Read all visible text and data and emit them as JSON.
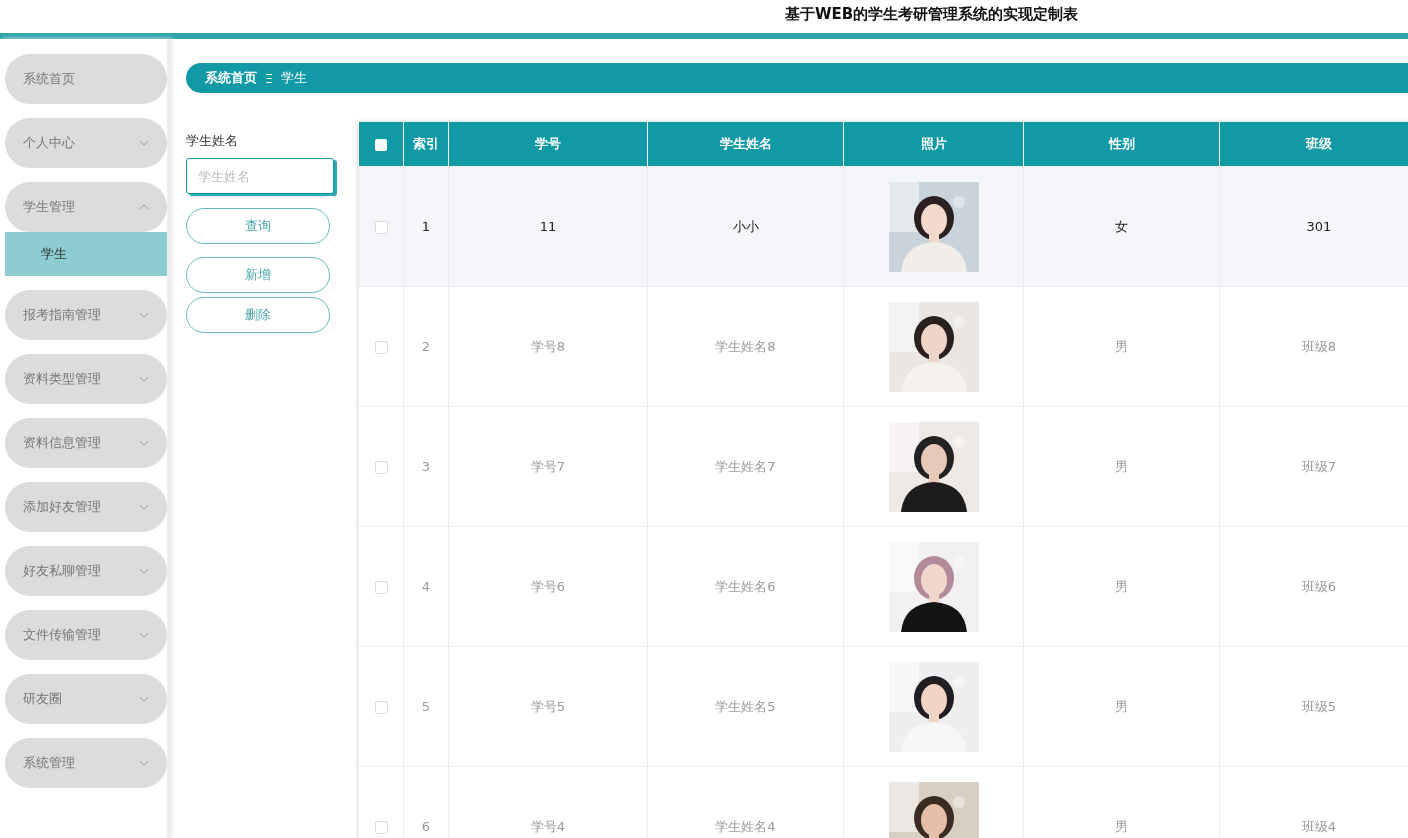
{
  "header": {
    "title": "基于WEB的学生考研管理系统的实现定制表"
  },
  "sidebar": {
    "items": [
      {
        "label": "系统首页",
        "expandable": false
      },
      {
        "label": "个人中心",
        "expandable": true,
        "expanded": false
      },
      {
        "label": "学生管理",
        "expandable": true,
        "expanded": true,
        "children": [
          {
            "label": "学生",
            "selected": true
          }
        ]
      },
      {
        "label": "报考指南管理",
        "expandable": true,
        "expanded": false
      },
      {
        "label": "资料类型管理",
        "expandable": true,
        "expanded": false
      },
      {
        "label": "资料信息管理",
        "expandable": true,
        "expanded": false
      },
      {
        "label": "添加好友管理",
        "expandable": true,
        "expanded": false
      },
      {
        "label": "好友私聊管理",
        "expandable": true,
        "expanded": false
      },
      {
        "label": "文件传输管理",
        "expandable": true,
        "expanded": false
      },
      {
        "label": "研友圈",
        "expandable": true,
        "expanded": false
      },
      {
        "label": "系统管理",
        "expandable": true,
        "expanded": false
      }
    ]
  },
  "breadcrumb": {
    "items": [
      "系统首页",
      "学生"
    ],
    "separator": "Ξ"
  },
  "search": {
    "label": "学生姓名",
    "placeholder": "学生姓名",
    "buttons": [
      "查询",
      "新增",
      "删除"
    ]
  },
  "table": {
    "columns": [
      "索引",
      "学号",
      "学生姓名",
      "照片",
      "性别",
      "班级"
    ],
    "header_checked": false,
    "rows": [
      {
        "index": "1",
        "student_no": "11",
        "name": "小小",
        "gender": "女",
        "class": "301",
        "checked": false,
        "highlighted": true
      },
      {
        "index": "2",
        "student_no": "学号8",
        "name": "学生姓名8",
        "gender": "男",
        "class": "班级8",
        "checked": false,
        "highlighted": false
      },
      {
        "index": "3",
        "student_no": "学号7",
        "name": "学生姓名7",
        "gender": "男",
        "class": "班级7",
        "checked": false,
        "highlighted": false
      },
      {
        "index": "4",
        "student_no": "学号6",
        "name": "学生姓名6",
        "gender": "男",
        "class": "班级6",
        "checked": false,
        "highlighted": false
      },
      {
        "index": "5",
        "student_no": "学号5",
        "name": "学生姓名5",
        "gender": "男",
        "class": "班级5",
        "checked": false,
        "highlighted": false
      },
      {
        "index": "6",
        "student_no": "学号4",
        "name": "学生姓名4",
        "gender": "男",
        "class": "班级4",
        "checked": false,
        "highlighted": false
      }
    ]
  }
}
